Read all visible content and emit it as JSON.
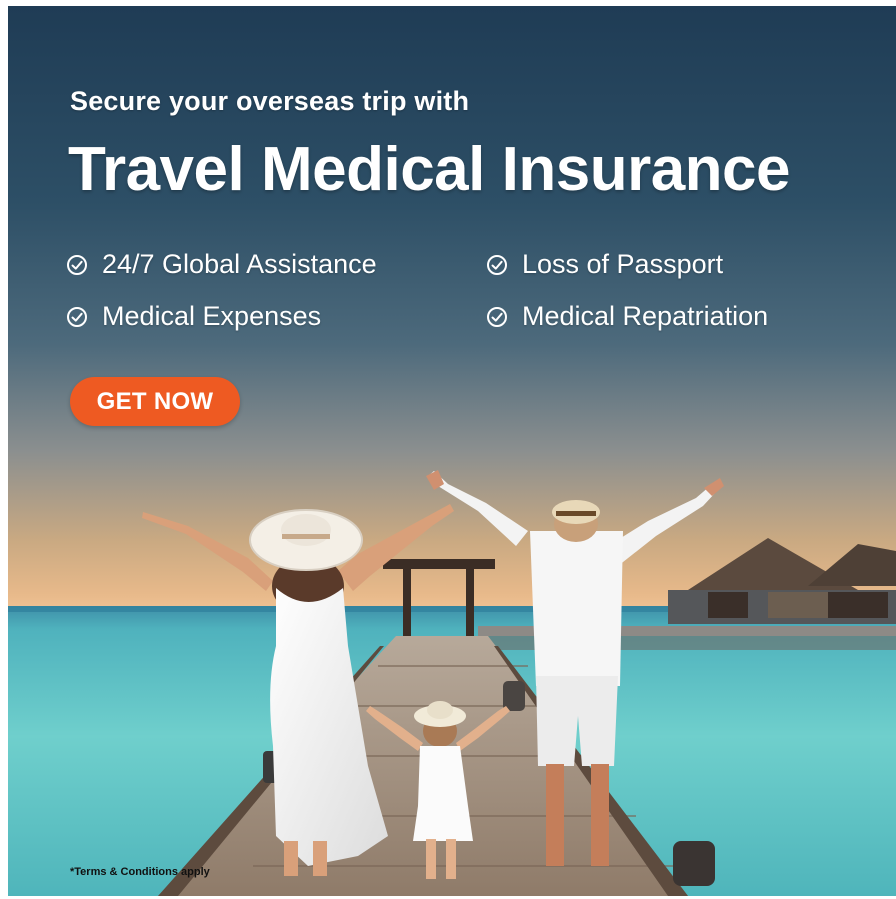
{
  "ad": {
    "headline_small": "Secure your overseas trip with",
    "headline_big": "Travel Medical Insurance",
    "features": [
      "24/7 Global Assistance",
      "Medical Expenses",
      "Loss of Passport",
      "Medical Repatriation"
    ],
    "cta_label": "GET NOW",
    "terms": "*Terms & Conditions apply"
  },
  "colors": {
    "cta_background": "#ee5a22",
    "text": "#ffffff",
    "sea": "#5fc3c4",
    "sky_top": "#1f3c55"
  },
  "icons": {
    "feature_bullet": "check-circle-icon"
  },
  "image": {
    "subject": "family-on-pier-photo"
  }
}
